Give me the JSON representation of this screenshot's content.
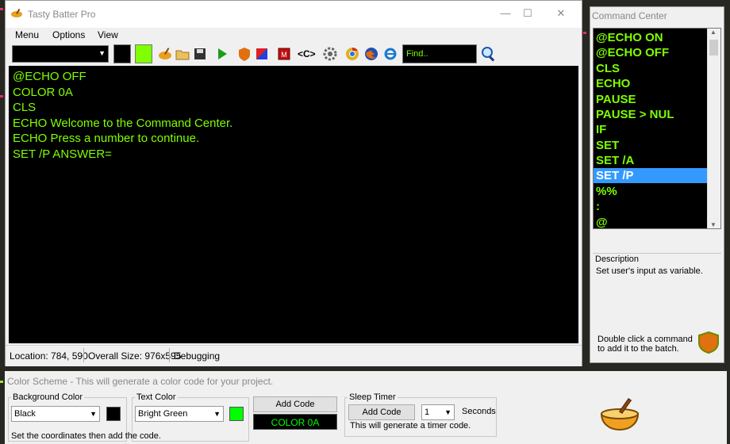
{
  "app": {
    "title": "Tasty Batter Pro",
    "window_buttons": [
      "—",
      "☐",
      "✕"
    ]
  },
  "menu": [
    "Menu",
    "Options",
    "View"
  ],
  "toolbar": {
    "font_combo_value": "",
    "search_placeholder": "Find..",
    "color_a": "#000000",
    "color_b": "#7fff00",
    "code_button": "<C>"
  },
  "editor": {
    "lines": [
      "@ECHO OFF",
      "COLOR 0A",
      "CLS",
      "ECHO Welcome to the Command Center.",
      "ECHO Press a number to continue.",
      "SET /P ANSWER="
    ],
    "text_color": "#7fff00",
    "background": "#000000"
  },
  "status": {
    "location": "Location: 784, 590",
    "overall_size": "Overall Size: 976x595",
    "mode": "Debugging"
  },
  "command_center": {
    "title": "Command Center",
    "items": [
      "@ECHO ON",
      "@ECHO OFF",
      "CLS",
      "ECHO",
      "PAUSE",
      "PAUSE > NUL",
      "IF",
      "SET",
      "SET /A",
      "SET /P",
      "%%",
      ":",
      "@"
    ],
    "selected_index": 9,
    "description_label": "Description",
    "description": "Set user's input as variable.",
    "hint": "Double click a command to add it to the batch."
  },
  "color_scheme": {
    "title": "Color Scheme - This will generate a color code for your project.",
    "background_label": "Background Color",
    "background_value": "Black",
    "background_swatch": "#000000",
    "text_label": "Text Color",
    "text_value": "Bright Green",
    "text_swatch": "#00ff00",
    "add_code_label": "Add Code",
    "color_code": "COLOR 0A",
    "coords_hint": "Set the coordinates then add the code.",
    "sleep_label": "Sleep Timer",
    "sleep_add_code": "Add Code",
    "sleep_value": "1",
    "seconds_label": "Seconds",
    "sleep_hint": "This will generate a timer code."
  }
}
